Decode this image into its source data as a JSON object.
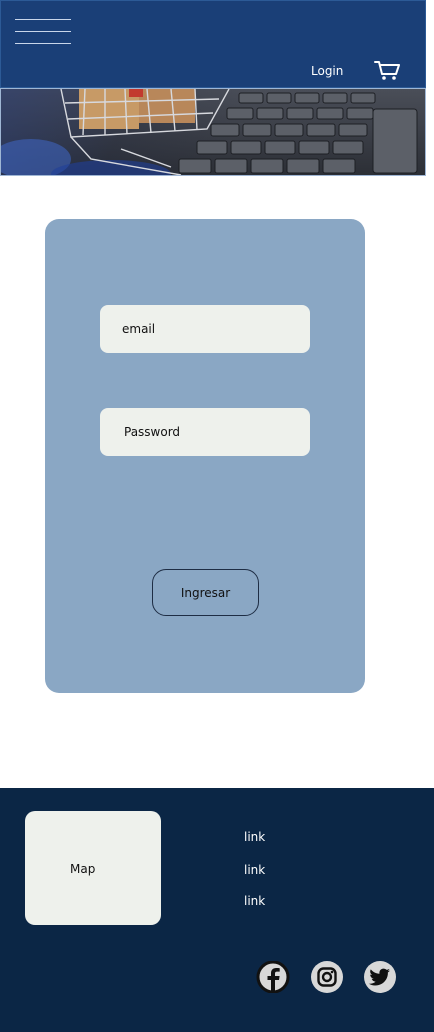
{
  "header": {
    "menu_icon": "hamburger-menu-icon",
    "login_label": "Login",
    "cart_icon": "shopping-cart-icon",
    "background_color": "#1a3f77"
  },
  "hero": {
    "image_description_icon": "shopping-cart-on-laptop-keyboard-image"
  },
  "login_form": {
    "email_placeholder": "email",
    "password_placeholder": "Password",
    "submit_label": "Ingresar",
    "card_color": "#8aa7c4"
  },
  "footer": {
    "map_label": "Map",
    "links": [
      "link",
      "link",
      "link"
    ],
    "social": [
      {
        "icon": "facebook-icon"
      },
      {
        "icon": "instagram-icon"
      },
      {
        "icon": "twitter-icon"
      }
    ],
    "background_color": "#0b2645"
  }
}
